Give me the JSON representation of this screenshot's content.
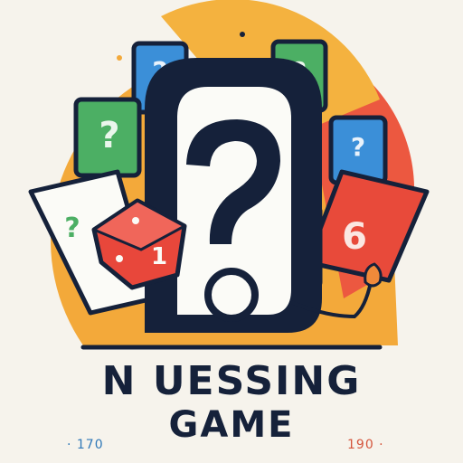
{
  "logo": {
    "title_line1": "N UESSING",
    "title_line2": "GAME"
  },
  "numbers": {
    "left": "· 170",
    "right": "190 ·"
  },
  "colors": {
    "background": "#f6f3ec",
    "outline": "#15213a",
    "sun_orange": "#f3a93a",
    "red": "#e84a3a",
    "green": "#4caf64",
    "blue": "#3b8fd8",
    "card_white": "#fbfbf7",
    "dice_red": "#e8473b"
  },
  "card_glyphs": {
    "blue_top": "?",
    "green_left": "?",
    "green_top_right": "?",
    "blue_right": "?",
    "white_card": "?",
    "red_card": "6",
    "dice_face": "1"
  }
}
